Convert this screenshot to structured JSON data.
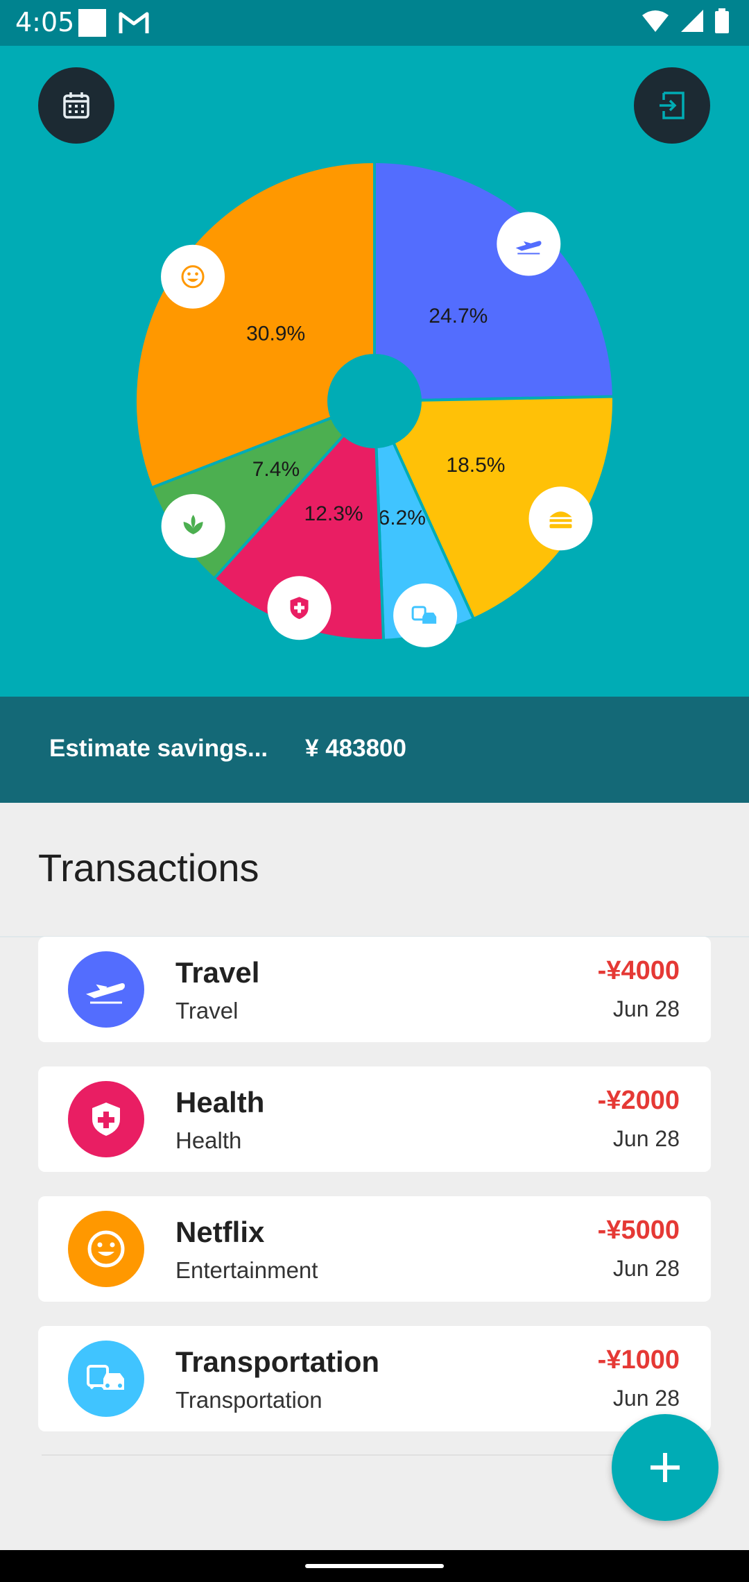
{
  "status_bar": {
    "time": "4:05"
  },
  "header": {
    "left_button_icon": "calendar-icon",
    "right_button_icon": "exit-icon"
  },
  "chart_data": {
    "type": "pie",
    "slices": [
      {
        "label": "Travel",
        "value": 24.7,
        "display": "24.7%",
        "color": "#536DFE",
        "icon": "plane-icon"
      },
      {
        "label": "Food",
        "value": 18.5,
        "display": "18.5%",
        "color": "#FFC107",
        "icon": "burger-icon"
      },
      {
        "label": "Transportation",
        "value": 6.2,
        "display": "6.2%",
        "color": "#40C4FF",
        "icon": "car-icon"
      },
      {
        "label": "Health",
        "value": 12.3,
        "display": "12.3%",
        "color": "#E91E63",
        "icon": "health-shield-icon"
      },
      {
        "label": "Nature",
        "value": 7.4,
        "display": "7.4%",
        "color": "#4CAF50",
        "icon": "leaf-icon"
      },
      {
        "label": "Entertainment",
        "value": 30.9,
        "display": "30.9%",
        "color": "#FF9800",
        "icon": "smiley-icon"
      }
    ]
  },
  "savings": {
    "label": "Estimate savings...",
    "value": "¥ 483800"
  },
  "transactions": {
    "title": "Transactions",
    "items": [
      {
        "title": "Travel",
        "category": "Travel",
        "amount": "-¥4000",
        "date": "Jun 28",
        "icon": "plane-icon",
        "color": "#536DFE"
      },
      {
        "title": "Health",
        "category": "Health",
        "amount": "-¥2000",
        "date": "Jun 28",
        "icon": "health-shield-icon",
        "color": "#E91E63"
      },
      {
        "title": "Netflix",
        "category": "Entertainment",
        "amount": "-¥5000",
        "date": "Jun 28",
        "icon": "smiley-icon",
        "color": "#FF9800"
      },
      {
        "title": "Transportation",
        "category": "Transportation",
        "amount": "-¥1000",
        "date": "Jun 28",
        "icon": "car-icon",
        "color": "#40C4FF"
      }
    ]
  },
  "fab": {
    "icon": "plus-icon"
  }
}
